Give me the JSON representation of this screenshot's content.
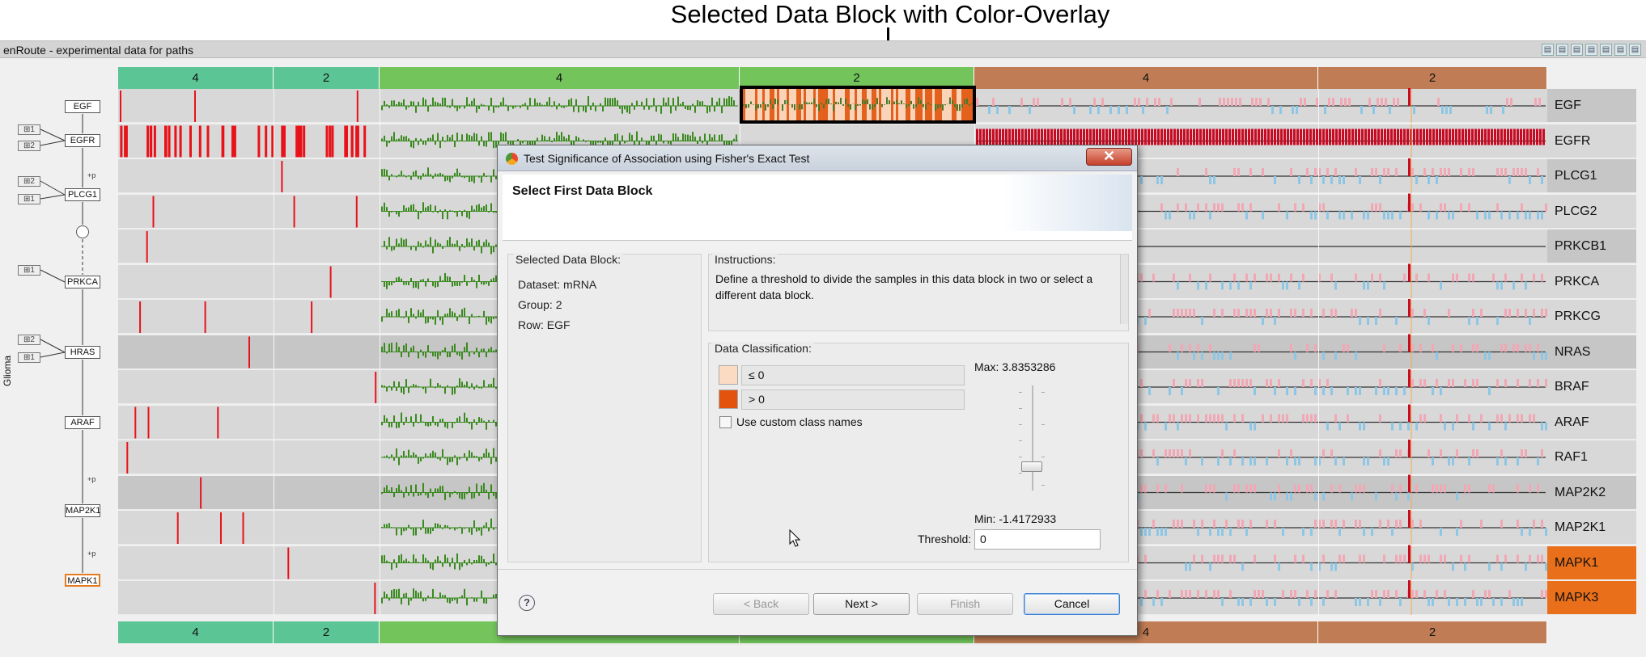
{
  "annotation": {
    "title": "Selected Data Block with Color-Overlay"
  },
  "view": {
    "title": "enRoute - experimental data for paths",
    "toolbar_icons": [
      "view-icon-1",
      "view-icon-2",
      "view-icon-3",
      "view-icon-4",
      "view-icon-5",
      "view-icon-6",
      "view-icon-7"
    ]
  },
  "groups": {
    "header": [
      "4",
      "2",
      "4",
      "2",
      "4",
      "2"
    ],
    "footer": [
      "4",
      "2",
      "",
      "",
      "4",
      "2"
    ]
  },
  "rows": [
    "EGF",
    "EGFR",
    "PLCG1",
    "PLCG2",
    "PRKCB1",
    "PRKCA",
    "PRKCG",
    "NRAS",
    "BRAF",
    "ARAF",
    "RAF1",
    "MAP2K2",
    "MAP2K1",
    "MAPK1",
    "MAPK3"
  ],
  "highlighted_rows": [
    "MAPK1",
    "MAPK3"
  ],
  "pathway": {
    "nodes": [
      "EGF",
      "EGFR",
      "PLCG1",
      "PRKCA",
      "HRAS",
      "ARAF",
      "MAP2K1",
      "MAPK1"
    ],
    "mini_nodes": [
      "1",
      "2",
      "2",
      "1",
      "1",
      "2",
      "1"
    ],
    "edge_label": "+p",
    "side_label": "Glioma"
  },
  "colors": {
    "group_teal": "#5bc596",
    "group_green": "#72c45b",
    "group_brown": "#c07d55",
    "mutation_red": "#e8121a",
    "copy_red": "#c80a23",
    "expression_green": "#3a8a1f",
    "overlay_orange": "#e3530d",
    "overlay_light": "#fbdcc3",
    "highlight_orange": "#e96f1a"
  },
  "dialog": {
    "title": "Test Significance of Association using Fisher's Exact Test",
    "heading": "Select First Data Block",
    "selected_block": {
      "title": "Selected Data Block:",
      "dataset": "Dataset: mRNA",
      "group": "Group: 2",
      "row": "Row: EGF"
    },
    "instructions": {
      "title": "Instructions:",
      "text": "Define a threshold to divide the samples in this data block in two or select a different data block."
    },
    "classification": {
      "title": "Data Classification:",
      "class_low": "≤ 0",
      "class_high": "> 0",
      "custom_names_label": "Use custom class names",
      "custom_names_checked": false,
      "max_label": "Max: 3.8353286",
      "min_label": "Min: -1.4172933",
      "threshold_label": "Threshold:",
      "threshold_value": "0"
    },
    "buttons": {
      "back": "< Back",
      "next": "Next >",
      "finish": "Finish",
      "cancel": "Cancel"
    },
    "help": "?",
    "close": "✕"
  }
}
